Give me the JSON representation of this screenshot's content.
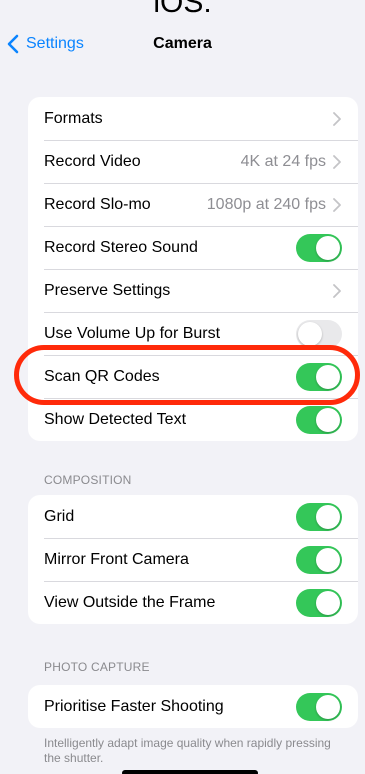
{
  "top_cut_text": "iOS:",
  "navbar": {
    "back_label": "Settings",
    "title": "Camera"
  },
  "group1": [
    {
      "label": "Formats",
      "type": "chevron",
      "value": ""
    },
    {
      "label": "Record Video",
      "type": "chevron",
      "value": "4K at 24 fps"
    },
    {
      "label": "Record Slo-mo",
      "type": "chevron",
      "value": "1080p at 240 fps"
    },
    {
      "label": "Record Stereo Sound",
      "type": "toggle",
      "on": true
    },
    {
      "label": "Preserve Settings",
      "type": "chevron",
      "value": ""
    },
    {
      "label": "Use Volume Up for Burst",
      "type": "toggle",
      "on": false
    },
    {
      "label": "Scan QR Codes",
      "type": "toggle",
      "on": true
    },
    {
      "label": "Show Detected Text",
      "type": "toggle",
      "on": true
    }
  ],
  "composition": {
    "header": "COMPOSITION",
    "items": [
      {
        "label": "Grid",
        "on": true
      },
      {
        "label": "Mirror Front Camera",
        "on": true
      },
      {
        "label": "View Outside the Frame",
        "on": true
      }
    ]
  },
  "photo_capture": {
    "header": "PHOTO CAPTURE",
    "items": [
      {
        "label": "Prioritise Faster Shooting",
        "on": true
      }
    ],
    "footer": "Intelligently adapt image quality when rapidly pressing the shutter."
  },
  "colors": {
    "accent": "#0a84ff",
    "toggle_on": "#34c759",
    "highlight": "#ff2a0a"
  },
  "icons": {
    "back": "chevron-left-icon",
    "disclosure": "chevron-right-icon"
  }
}
